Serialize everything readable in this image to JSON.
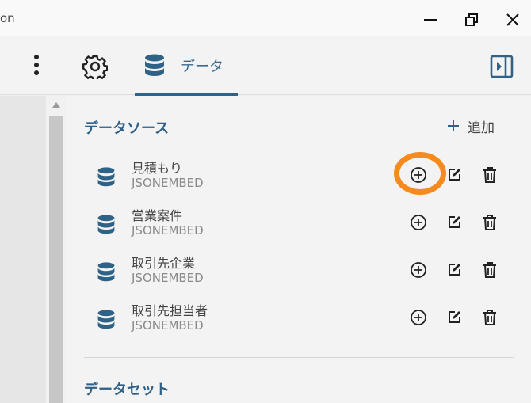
{
  "window": {
    "title_fragment": "on"
  },
  "toolbar": {
    "tab_data_label": "データ"
  },
  "datasource": {
    "section_title": "データソース",
    "add_label": "追加",
    "items": [
      {
        "name": "見積もり",
        "type": "JSONEMBED"
      },
      {
        "name": "営業案件",
        "type": "JSONEMBED"
      },
      {
        "name": "取引先企業",
        "type": "JSONEMBED"
      },
      {
        "name": "取引先担当者",
        "type": "JSONEMBED"
      }
    ]
  },
  "dataset": {
    "section_title": "データセット"
  },
  "colors": {
    "accent": "#2e6286",
    "highlight": "#f58a1f"
  },
  "icons": [
    "more-vertical-icon",
    "gear-icon",
    "database-icon",
    "panel-toggle-icon",
    "plus-circle-icon",
    "edit-icon",
    "trash-icon",
    "plus-icon"
  ]
}
